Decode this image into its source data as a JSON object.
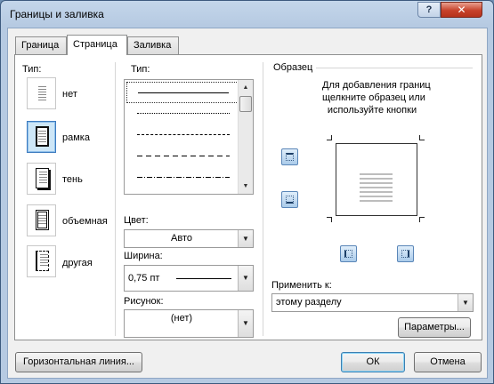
{
  "window": {
    "title": "Границы и заливка",
    "help_label": "?",
    "close_label": "✕"
  },
  "tabs": [
    {
      "label": "Граница",
      "active": false
    },
    {
      "label": "Страница",
      "active": true
    },
    {
      "label": "Заливка",
      "active": false
    }
  ],
  "setting": {
    "label": "Тип:",
    "items": [
      {
        "label": "нет",
        "selected": false
      },
      {
        "label": "рамка",
        "selected": true
      },
      {
        "label": "тень",
        "selected": false
      },
      {
        "label": "объемная",
        "selected": false
      },
      {
        "label": "другая",
        "selected": false
      }
    ]
  },
  "style": {
    "label": "Тип:",
    "items": [
      "solid",
      "dotted",
      "dashed-small",
      "dashed",
      "dash-dot"
    ],
    "selected_index": 0
  },
  "color": {
    "label": "Цвет:",
    "value": "Авто"
  },
  "width": {
    "label": "Ширина:",
    "value": "0,75 пт"
  },
  "art": {
    "label": "Рисунок:",
    "value": "(нет)"
  },
  "preview": {
    "label": "Образец",
    "hint_line1": "Для добавления границ",
    "hint_line2": "щелкните образец или",
    "hint_line3": "используйте кнопки"
  },
  "apply_to": {
    "label": "Применить к:",
    "value": "этому разделу"
  },
  "buttons": {
    "options": "Параметры...",
    "horizontal_line": "Горизонтальная линия...",
    "ok": "ОК",
    "cancel": "Отмена"
  },
  "colors": {
    "accent": "#3d7bbf",
    "selected_bg": "#cde6f7"
  }
}
